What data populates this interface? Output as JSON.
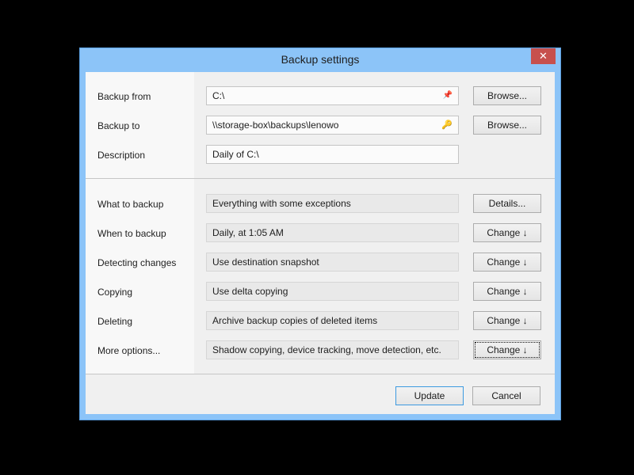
{
  "window": {
    "title": "Backup settings",
    "close_label": "✕"
  },
  "paths": [
    {
      "label": "Backup from",
      "value": "C:\\",
      "icon": "pin-icon",
      "glyph": "📌",
      "button": "Browse..."
    },
    {
      "label": "Backup to",
      "value": "\\\\storage-box\\backups\\lenowo",
      "icon": "key-icon",
      "glyph": "🔑",
      "button": "Browse..."
    },
    {
      "label": "Description",
      "value": "Daily of C:\\"
    }
  ],
  "options": [
    {
      "label": "What to backup",
      "value": "Everything with some exceptions",
      "button": "Details..."
    },
    {
      "label": "When to backup",
      "value": "Daily, at 1:05 AM",
      "button": "Change ↓"
    },
    {
      "label": "Detecting changes",
      "value": "Use destination snapshot",
      "button": "Change ↓"
    },
    {
      "label": "Copying",
      "value": "Use delta copying",
      "button": "Change ↓"
    },
    {
      "label": "Deleting",
      "value": "Archive backup copies of deleted items",
      "button": "Change ↓"
    },
    {
      "label": "More options...",
      "value": "Shadow copying, device tracking, move detection, etc.",
      "button": "Change ↓"
    }
  ],
  "footer": {
    "update_label": "Update",
    "cancel_label": "Cancel"
  },
  "colors": {
    "titlebar": "#8cc4f8",
    "close": "#c7504d",
    "default_button_border": "#3c9ae0"
  }
}
